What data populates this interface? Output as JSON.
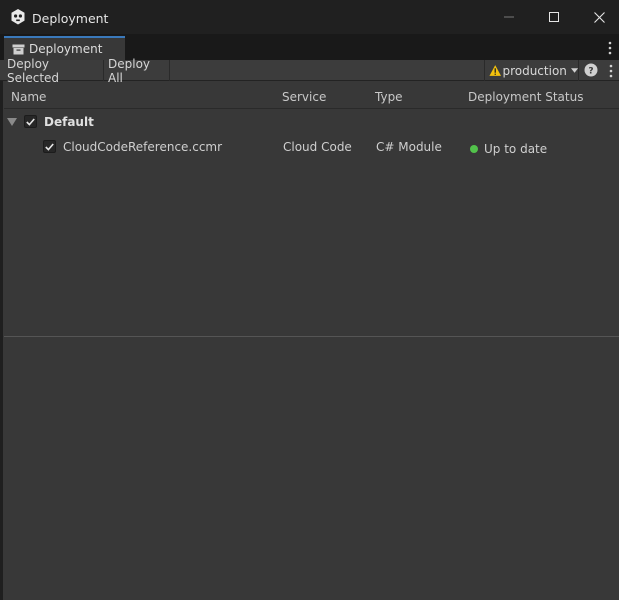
{
  "window": {
    "title": "Deployment",
    "icon": "unity-logo-icon",
    "controls": [
      "minimize-icon",
      "maximize-icon",
      "close-icon"
    ]
  },
  "tab": {
    "label": "Deployment",
    "icon": "archive-box-icon"
  },
  "toolbar": {
    "deploy_selected": "Deploy Selected",
    "deploy_all": "Deploy All",
    "environment": "production",
    "environment_warning_icon": "warning-icon",
    "help_icon": "help-icon",
    "menu_icon": "kebab-menu-icon"
  },
  "table": {
    "columns": [
      "Name",
      "Service",
      "Type",
      "Deployment Status"
    ],
    "groups": [
      {
        "label": "Default",
        "checked": true,
        "expanded": true,
        "items": [
          {
            "name": "CloudCodeReference.ccmr",
            "service": "Cloud Code",
            "type": "C# Module",
            "status": "Up to date",
            "status_color": "#52c24b",
            "checked": true
          }
        ]
      }
    ]
  },
  "colors": {
    "background": "#383838",
    "titlebar": "#202020",
    "tab_accent": "#3a79bb",
    "warning": "#f4c20d"
  }
}
